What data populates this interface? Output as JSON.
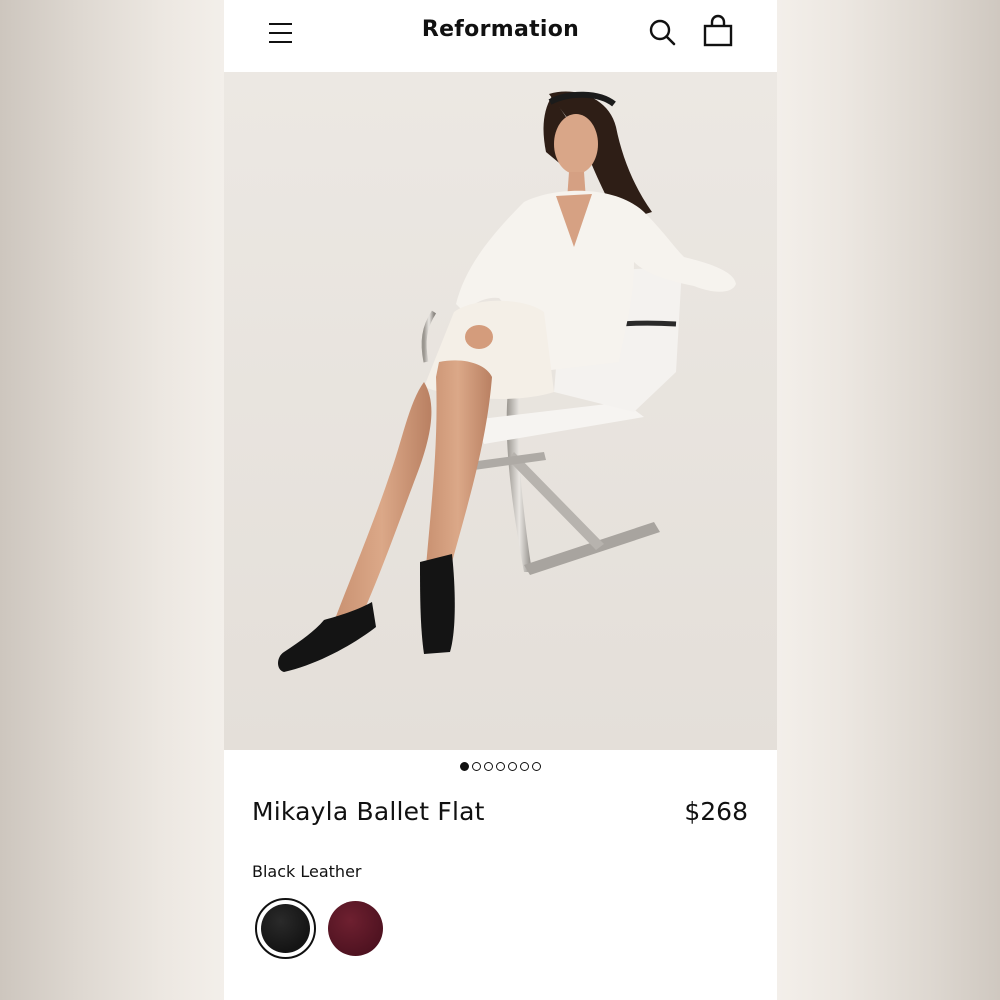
{
  "header": {
    "brand": "Reformation",
    "menu_icon": "hamburger-menu-icon",
    "search_icon": "search-icon",
    "bag_icon": "shopping-bag-icon"
  },
  "gallery": {
    "image_count": 7,
    "active_index": 0
  },
  "product": {
    "name": "Mikayla Ballet Flat",
    "price": "$268",
    "selected_color": "Black Leather",
    "swatches": [
      {
        "name": "black",
        "color": "#1a1a1a",
        "selected": true
      },
      {
        "name": "wine",
        "color": "#5e1726",
        "selected": false
      }
    ]
  },
  "colors": {
    "text": "#111111",
    "background": "#ffffff"
  }
}
